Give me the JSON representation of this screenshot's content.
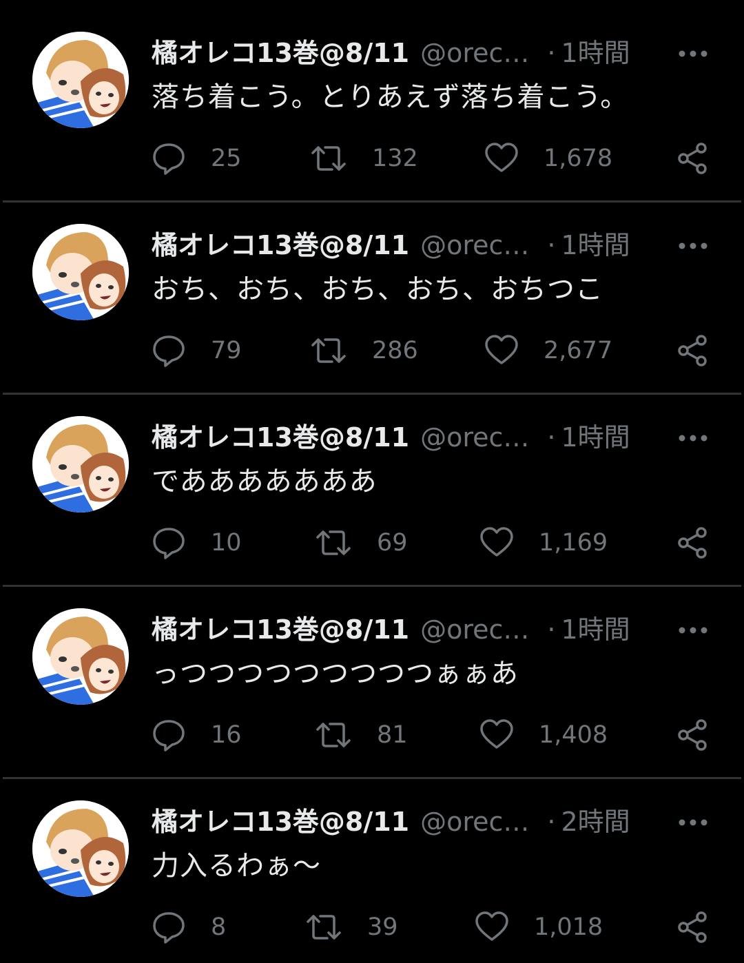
{
  "colors": {
    "background": "#000000",
    "text_primary": "#e7e9ea",
    "text_secondary": "#71767b",
    "divider": "#2f3336"
  },
  "tweets": [
    {
      "name": "橘オレコ13巻@8/11",
      "handle": "@orec…",
      "separator": "·",
      "time": "1時間",
      "text": "落ち着こう。とりあえず落ち着こう。",
      "replies": "25",
      "retweets": "132",
      "likes": "1,678",
      "icons": [
        "avatar",
        "more-icon",
        "reply-icon",
        "retweet-icon",
        "like-icon",
        "share-icon"
      ]
    },
    {
      "name": "橘オレコ13巻@8/11",
      "handle": "@orec…",
      "separator": "·",
      "time": "1時間",
      "text": "おち、おち、おち、おち、おちつこ",
      "replies": "79",
      "retweets": "286",
      "likes": "2,677",
      "icons": [
        "avatar",
        "more-icon",
        "reply-icon",
        "retweet-icon",
        "like-icon",
        "share-icon"
      ]
    },
    {
      "name": "橘オレコ13巻@8/11",
      "handle": "@orec…",
      "separator": "·",
      "time": "1時間",
      "text": "であああああああ",
      "replies": "10",
      "retweets": "69",
      "likes": "1,169",
      "icons": [
        "avatar",
        "more-icon",
        "reply-icon",
        "retweet-icon",
        "like-icon",
        "share-icon"
      ]
    },
    {
      "name": "橘オレコ13巻@8/11",
      "handle": "@orec…",
      "separator": "·",
      "time": "1時間",
      "text": "っつつつつつつつつつぁぁあ",
      "replies": "16",
      "retweets": "81",
      "likes": "1,408",
      "icons": [
        "avatar",
        "more-icon",
        "reply-icon",
        "retweet-icon",
        "like-icon",
        "share-icon"
      ]
    },
    {
      "name": "橘オレコ13巻@8/11",
      "handle": "@orec…",
      "separator": "·",
      "time": "2時間",
      "text": "力入るわぁ〜",
      "replies": "8",
      "retweets": "39",
      "likes": "1,018",
      "icons": [
        "avatar",
        "more-icon",
        "reply-icon",
        "retweet-icon",
        "like-icon",
        "share-icon"
      ]
    }
  ]
}
